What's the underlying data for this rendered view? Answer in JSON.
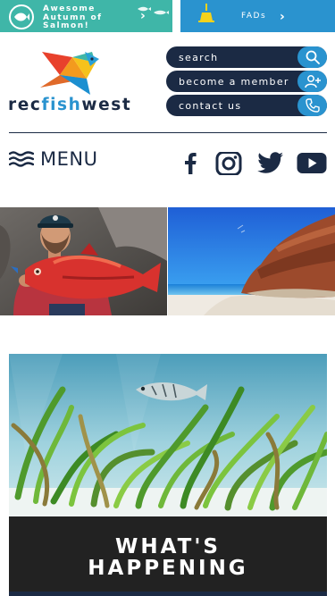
{
  "promos": {
    "salmon": {
      "line1": "Awesome",
      "line2": "Autumn of",
      "line3": "Salmon!"
    },
    "fads": {
      "label": "FADs"
    }
  },
  "logo": {
    "part1": "rec",
    "part2": "fish",
    "part3": "west"
  },
  "quick_links": {
    "search": "search",
    "member": "become a member",
    "contact": "contact us"
  },
  "menu": {
    "label": "MENU"
  },
  "social": [
    "facebook",
    "instagram",
    "twitter",
    "youtube"
  ],
  "feature": {
    "title_line1": "WHAT'S",
    "title_line2": "HAPPENING"
  },
  "colors": {
    "navy": "#1b2a44",
    "blue": "#2a93cf",
    "teal": "#3fb6a8"
  }
}
